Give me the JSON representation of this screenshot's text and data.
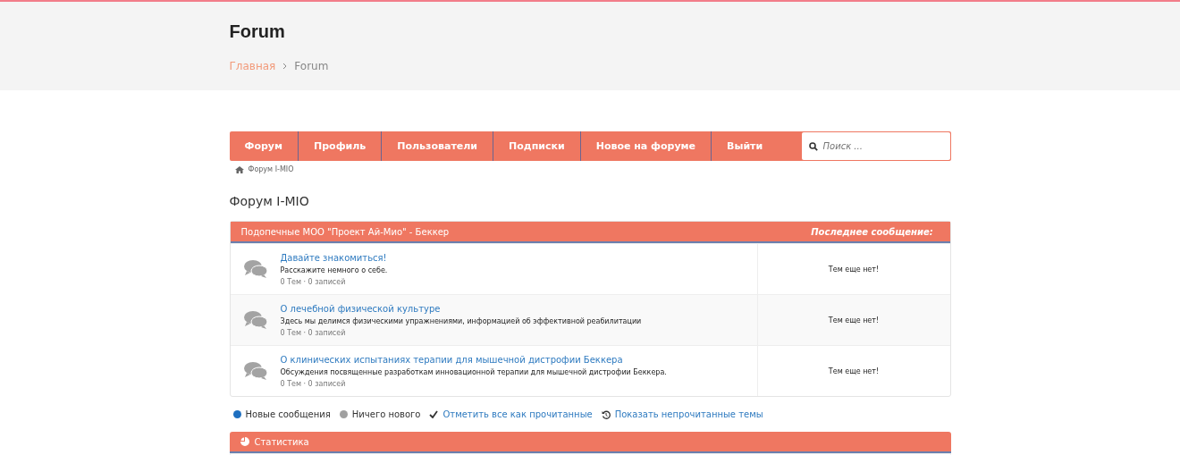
{
  "header": {
    "title": "Forum",
    "breadcrumb": [
      {
        "label": "Главная",
        "link": true
      },
      {
        "label": "Forum",
        "link": false
      }
    ]
  },
  "nav": {
    "items": [
      "Форум",
      "Профиль",
      "Пользователи",
      "Подписки",
      "Новое на форуме",
      "Выйти"
    ],
    "search": {
      "placeholder": "Поиск ..."
    }
  },
  "location": "Форум I-MIO",
  "page_title": "Форум I-MIO",
  "category": {
    "title": "Подопечные МОО \"Проект Ай-Мио\" - Беккер",
    "last_post_heading": "Последнее сообщение:",
    "forums": [
      {
        "name": "Давайте знакомиться!",
        "description": "Расскажите немного о себе.",
        "stats": "0 Тем · 0 записей",
        "last_post": "Тем еще нет!"
      },
      {
        "name": "О лечебной физической культуре",
        "description": "Здесь мы делимся физическими упражнениями, информацией об эффективной реабилитации",
        "stats": "0 Тем · 0 записей",
        "last_post": "Тем еще нет!"
      },
      {
        "name": "О клинических испытаниях терапии для мышечной дистрофии Беккера",
        "description": "Обсуждения посвященные разработкам инновационной терапии для мышечной дистрофии Беккера.",
        "stats": "0 Тем · 0 записей",
        "last_post": "Тем еще нет!"
      }
    ]
  },
  "legend": [
    {
      "kind": "dot",
      "label": "Новые сообщения",
      "color": "#1e6fc0"
    },
    {
      "kind": "dot",
      "label": "Ничего нового",
      "color": "#a0a0a0"
    },
    {
      "kind": "check",
      "label": "Отметить все как прочитанные"
    },
    {
      "kind": "history",
      "label": "Показать непрочитанные темы"
    }
  ],
  "statistics": {
    "title": "Статистика"
  }
}
